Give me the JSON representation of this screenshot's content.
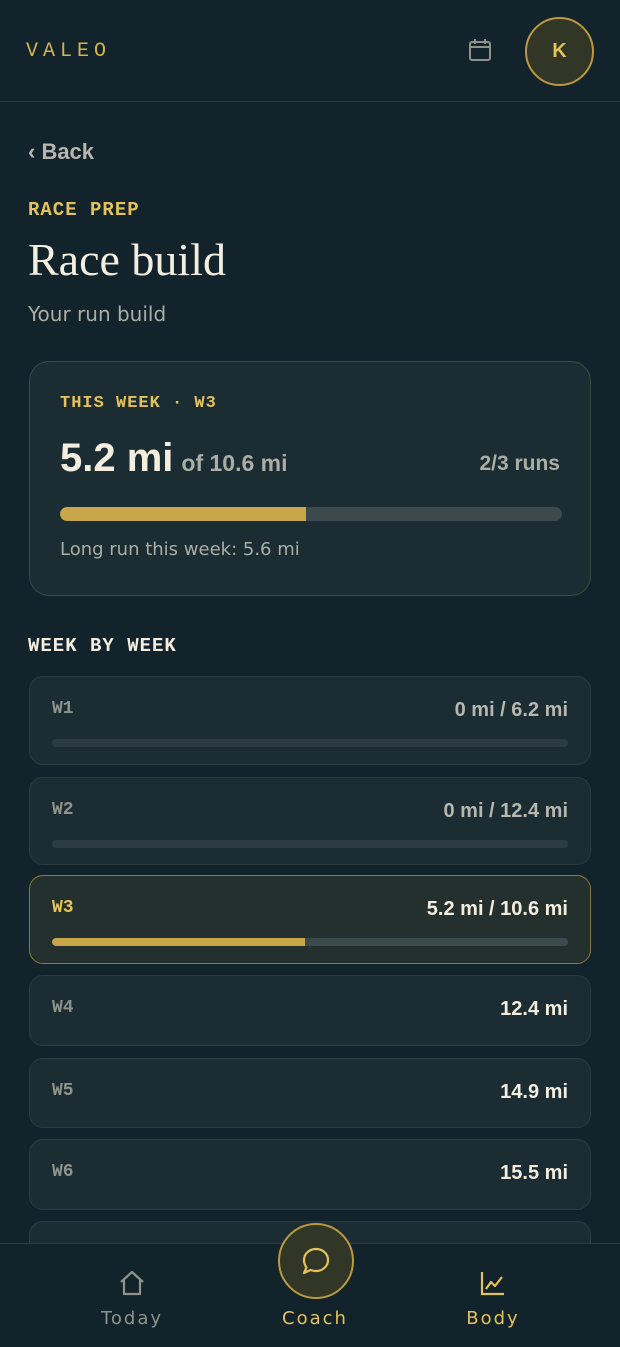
{
  "header": {
    "brand": "VALEO",
    "avatar_initial": "K"
  },
  "page": {
    "back_label": "‹ Back",
    "eyebrow": "RACE PREP",
    "title": "Race build",
    "subtitle": "Your run build"
  },
  "summary": {
    "label": "THIS WEEK · W3",
    "done": "5.2 mi",
    "of_total": "of 10.6 mi",
    "runs": "2/3 runs",
    "progress": 0.49,
    "long_run": "Long run this week: 5.6 mi"
  },
  "weeks_section": {
    "title": "WEEK BY WEEK",
    "items": [
      {
        "label": "W1",
        "distance": "0 mi / 6.2 mi",
        "progress": 0
      },
      {
        "label": "W2",
        "distance": "0 mi / 12.4 mi",
        "progress": 0
      },
      {
        "label": "W3",
        "distance": "5.2 mi / 10.6 mi",
        "progress": 0.49
      },
      {
        "label": "W4",
        "distance": "12.4 mi"
      },
      {
        "label": "W5",
        "distance": "14.9 mi"
      },
      {
        "label": "W6",
        "distance": "15.5 mi"
      }
    ]
  },
  "nav": {
    "today": "Today",
    "coach": "Coach",
    "body": "Body"
  },
  "colors": {
    "accent": "#e3c25a",
    "background": "#13232b",
    "card": "#1b2c33"
  },
  "icons": [
    "calendar-icon",
    "home-icon",
    "chat-bubble-icon",
    "chart-icon"
  ]
}
